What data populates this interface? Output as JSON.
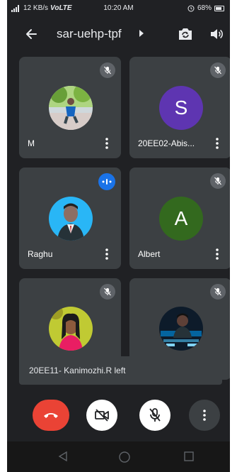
{
  "status": {
    "speed": "12 KB/s",
    "network": "VoLTE",
    "time": "10:20 AM",
    "battery": "68%"
  },
  "header": {
    "meeting_code": "sar-uehp-tpf",
    "icons": [
      "back-arrow-icon",
      "caret-right-icon",
      "flip-camera-icon",
      "speaker-icon"
    ]
  },
  "participants": [
    {
      "name": "M",
      "avatar_type": "photo",
      "mic": "muted"
    },
    {
      "name": "20EE02-Abis...",
      "avatar_type": "letter",
      "initial": "S",
      "avatar_color": "#5e35b1",
      "mic": "muted"
    },
    {
      "name": "Raghu",
      "avatar_type": "photo",
      "mic": "speaking"
    },
    {
      "name": "Albert",
      "avatar_type": "letter",
      "initial": "A",
      "avatar_color": "#33691e",
      "mic": "muted"
    },
    {
      "name": "",
      "avatar_type": "photo",
      "mic": "muted"
    },
    {
      "name": "",
      "avatar_type": "photo",
      "mic": "muted"
    }
  ],
  "toast": {
    "text": "20EE11- Kanimozhi.R left"
  },
  "controls": [
    "end-call-icon",
    "camera-off-icon",
    "mic-off-icon",
    "more-vert-icon"
  ],
  "colors": {
    "background": "#202124",
    "tile": "#3c4043",
    "end_call": "#ea4335",
    "speaking": "#1a73e8"
  }
}
